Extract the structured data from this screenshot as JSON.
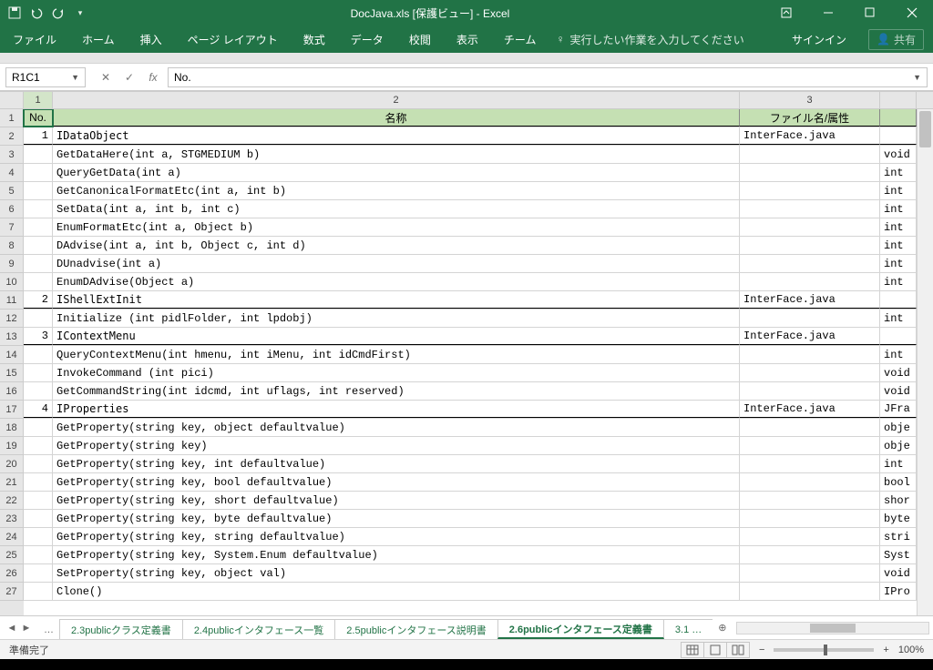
{
  "title": "DocJava.xls  [保護ビュー] - Excel",
  "qat_items": [
    "save",
    "undo",
    "redo",
    "customize"
  ],
  "ribbon": [
    "ファイル",
    "ホーム",
    "挿入",
    "ページ レイアウト",
    "数式",
    "データ",
    "校閲",
    "表示",
    "チーム"
  ],
  "tellme": "実行したい作業を入力してください",
  "signin": "サインイン",
  "share": "共有",
  "namebox": "R1C1",
  "formula": "No.",
  "col_widths": {
    "c1": 32,
    "c2": 754,
    "c3": 154,
    "c4": 40
  },
  "col_heads": [
    "1",
    "2",
    "3"
  ],
  "header_row": {
    "no": "No.",
    "name": "名称",
    "file": "ファイル名/属性"
  },
  "rows": [
    {
      "rn": 1,
      "no": "",
      "name": "No.",
      "file": "",
      "ret": "",
      "kind": "hdr"
    },
    {
      "rn": 2,
      "no": "1",
      "name": "IDataObject",
      "file": "InterFace.java",
      "ret": "",
      "kind": "sec"
    },
    {
      "rn": 3,
      "no": "",
      "name": "GetDataHere(int a, STGMEDIUM b)",
      "file": "",
      "ret": "void",
      "kind": ""
    },
    {
      "rn": 4,
      "no": "",
      "name": "QueryGetData(int a)",
      "file": "",
      "ret": "int",
      "kind": ""
    },
    {
      "rn": 5,
      "no": "",
      "name": "GetCanonicalFormatEtc(int a, int b)",
      "file": "",
      "ret": "int",
      "kind": ""
    },
    {
      "rn": 6,
      "no": "",
      "name": "SetData(int a, int b, int c)",
      "file": "",
      "ret": "int",
      "kind": ""
    },
    {
      "rn": 7,
      "no": "",
      "name": "EnumFormatEtc(int a, Object b)",
      "file": "",
      "ret": "int",
      "kind": ""
    },
    {
      "rn": 8,
      "no": "",
      "name": "DAdvise(int a, int b, Object c, int d)",
      "file": "",
      "ret": "int",
      "kind": ""
    },
    {
      "rn": 9,
      "no": "",
      "name": "DUnadvise(int a)",
      "file": "",
      "ret": "int",
      "kind": ""
    },
    {
      "rn": 10,
      "no": "",
      "name": "EnumDAdvise(Object a)",
      "file": "",
      "ret": "int",
      "kind": ""
    },
    {
      "rn": 11,
      "no": "2",
      "name": "IShellExtInit",
      "file": "InterFace.java",
      "ret": "",
      "kind": "sec"
    },
    {
      "rn": 12,
      "no": "",
      "name": "Initialize (int pidlFolder, int lpdobj)",
      "file": "",
      "ret": "int",
      "kind": ""
    },
    {
      "rn": 13,
      "no": "3",
      "name": "IContextMenu",
      "file": "InterFace.java",
      "ret": "",
      "kind": "sec"
    },
    {
      "rn": 14,
      "no": "",
      "name": "QueryContextMenu(int hmenu, int iMenu, int idCmdFirst)",
      "file": "",
      "ret": "int",
      "kind": ""
    },
    {
      "rn": 15,
      "no": "",
      "name": "InvokeCommand (int pici)",
      "file": "",
      "ret": "void",
      "kind": ""
    },
    {
      "rn": 16,
      "no": "",
      "name": "GetCommandString(int idcmd, int uflags, int reserved)",
      "file": "",
      "ret": "void",
      "kind": ""
    },
    {
      "rn": 17,
      "no": "4",
      "name": "IProperties",
      "file": "InterFace.java",
      "ret": "JFra",
      "kind": "sec"
    },
    {
      "rn": 18,
      "no": "",
      "name": "GetProperty(string key, object defaultvalue)",
      "file": "",
      "ret": "obje",
      "kind": ""
    },
    {
      "rn": 19,
      "no": "",
      "name": "GetProperty(string key)",
      "file": "",
      "ret": "obje",
      "kind": ""
    },
    {
      "rn": 20,
      "no": "",
      "name": "GetProperty(string key, int defaultvalue)",
      "file": "",
      "ret": "int",
      "kind": ""
    },
    {
      "rn": 21,
      "no": "",
      "name": "GetProperty(string key, bool defaultvalue)",
      "file": "",
      "ret": "bool",
      "kind": ""
    },
    {
      "rn": 22,
      "no": "",
      "name": "GetProperty(string key, short defaultvalue)",
      "file": "",
      "ret": "shor",
      "kind": ""
    },
    {
      "rn": 23,
      "no": "",
      "name": "GetProperty(string key, byte defaultvalue)",
      "file": "",
      "ret": "byte",
      "kind": ""
    },
    {
      "rn": 24,
      "no": "",
      "name": "GetProperty(string key, string defaultvalue)",
      "file": "",
      "ret": "stri",
      "kind": ""
    },
    {
      "rn": 25,
      "no": "",
      "name": "GetProperty(string key, System.Enum defaultvalue)",
      "file": "",
      "ret": "Syst",
      "kind": ""
    },
    {
      "rn": 26,
      "no": "",
      "name": "SetProperty(string key, object val)",
      "file": "",
      "ret": "void",
      "kind": ""
    },
    {
      "rn": 27,
      "no": "",
      "name": "Clone()",
      "file": "",
      "ret": "IPro",
      "kind": ""
    }
  ],
  "sheet_tabs": [
    {
      "label": "…",
      "active": false,
      "ellip": true
    },
    {
      "label": "2.3publicクラス定義書",
      "active": false
    },
    {
      "label": "2.4publicインタフェース一覧",
      "active": false
    },
    {
      "label": "2.5publicインタフェース説明書",
      "active": false
    },
    {
      "label": "2.6publicインタフェース定義書",
      "active": true
    },
    {
      "label": "3.1 …",
      "active": false
    }
  ],
  "status_text": "準備完了",
  "zoom": "100%"
}
